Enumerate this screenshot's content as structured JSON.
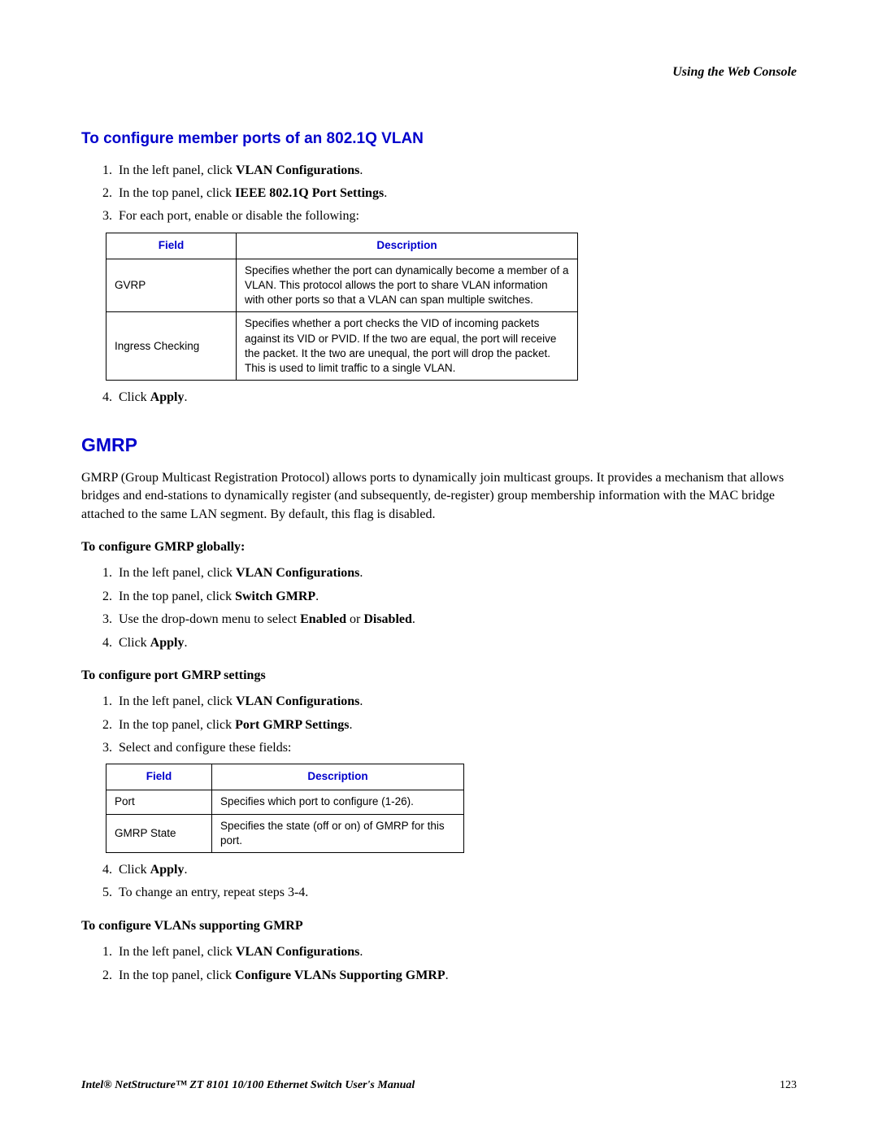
{
  "header": {
    "right": "Using the Web Console"
  },
  "section1": {
    "title": "To configure member ports of an 802.1Q VLAN",
    "list1": {
      "i1a": "In the left panel, click ",
      "i1b": "VLAN Configurations",
      "i1c": ".",
      "i2a": "In the top panel, click ",
      "i2b": "IEEE 802.1Q Port Settings",
      "i2c": ".",
      "i3": "For each port, enable or disable the following:"
    },
    "list2": {
      "i4a": "Click ",
      "i4b": "Apply",
      "i4c": "."
    }
  },
  "table1": {
    "h1": "Field",
    "h2": "Description",
    "r1c1": "GVRP",
    "r1c2": "Specifies whether the port can dynamically become a member of a VLAN. This protocol allows the port to share VLAN information with other ports so that a VLAN can span multiple switches.",
    "r2c1": "Ingress Checking",
    "r2c2": "Specifies whether a port checks the VID of incoming packets against its VID or PVID. If the two are equal, the port will receive the packet. It the two are unequal, the port will drop the packet. This is used to limit traffic to a single VLAN."
  },
  "section2": {
    "title": "GMRP",
    "intro": "GMRP (Group Multicast Registration Protocol) allows ports to dynamically join multicast groups. It provides a mechanism that allows bridges and end-stations to dynamically register (and subsequently, de-register) group membership information with the MAC bridge attached to the same LAN segment. By default, this flag is disabled.",
    "sub1": "To configure GMRP globally:",
    "list1": {
      "i1a": "In the left panel, click ",
      "i1b": "VLAN Configurations",
      "i1c": ".",
      "i2a": "In the top panel, click ",
      "i2b": "Switch GMRP",
      "i2c": ".",
      "i3a": "Use the drop-down menu to select ",
      "i3b": "Enabled",
      "i3c": " or ",
      "i3d": "Disabled",
      "i3e": ".",
      "i4a": "Click ",
      "i4b": "Apply",
      "i4c": "."
    },
    "sub2": "To configure port GMRP settings",
    "list2": {
      "i1a": "In the left panel, click ",
      "i1b": "VLAN Configurations",
      "i1c": ".",
      "i2a": "In the top panel, click ",
      "i2b": "Port GMRP Settings",
      "i2c": ".",
      "i3": "Select and configure these fields:"
    },
    "list3": {
      "i4a": "Click ",
      "i4b": "Apply",
      "i4c": ".",
      "i5": "To change an entry, repeat steps 3-4."
    },
    "sub3": "To configure VLANs supporting GMRP",
    "list4": {
      "i1a": "In the left panel, click ",
      "i1b": "VLAN Configurations",
      "i1c": ".",
      "i2a": "In the top panel, click ",
      "i2b": "Configure VLANs Supporting GMRP",
      "i2c": "."
    }
  },
  "table2": {
    "h1": "Field",
    "h2": "Description",
    "r1c1": "Port",
    "r1c2": "Specifies which port to configure (1-26).",
    "r2c1": "GMRP State",
    "r2c2": "Specifies the state (off or on) of GMRP for this port."
  },
  "footer": {
    "left": "Intel® NetStructure™ ZT 8101 10/100 Ethernet Switch User's Manual",
    "pageNum": "123"
  }
}
